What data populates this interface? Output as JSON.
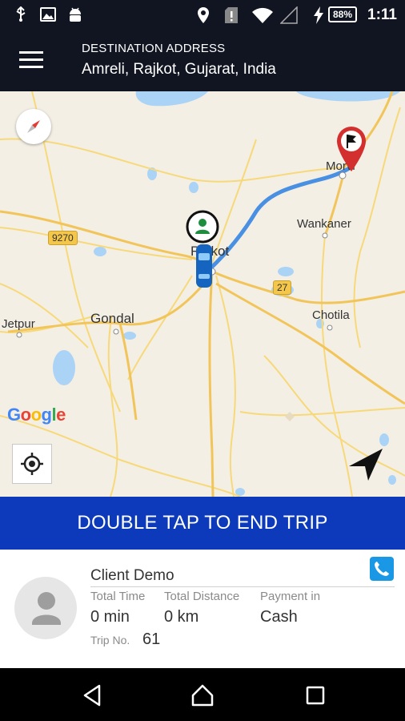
{
  "status_bar": {
    "time": "1:11",
    "battery": "88%",
    "icons": [
      "usb-icon",
      "image-icon",
      "android-icon",
      "location-icon",
      "sim-alert-icon",
      "wifi-icon",
      "signal-icon",
      "charging-icon"
    ]
  },
  "header": {
    "destination_label": "DESTINATION ADDRESS",
    "destination_value": "Amreli, Rajkot, Gujarat, India"
  },
  "map": {
    "places": {
      "morvi": "Morvi",
      "wankaner": "Wankaner",
      "rajkot": "Rajkot",
      "gondal": "Gondal",
      "chotila": "Chotila",
      "jetpur": "Jetpur"
    },
    "shields": {
      "road_9270": "9270",
      "road_27": "27"
    },
    "attribution": "Google",
    "route_color": "#4a90e2",
    "destination_marker_color": "#d32f2f",
    "origin_marker_color": "#1e8e3e"
  },
  "end_trip": {
    "label": "DOUBLE TAP TO END TRIP",
    "color": "#0d3aba"
  },
  "trip_info": {
    "client_name": "Client Demo",
    "stats": [
      {
        "label": "Total Time",
        "value": "0 min"
      },
      {
        "label": "Total Distance",
        "value": "0 km"
      },
      {
        "label": "Payment in",
        "value": "Cash"
      }
    ],
    "trip_no_label": "Trip No.",
    "trip_no_value": "61"
  },
  "nav_bar": {
    "buttons": [
      "back",
      "home",
      "recents"
    ]
  }
}
